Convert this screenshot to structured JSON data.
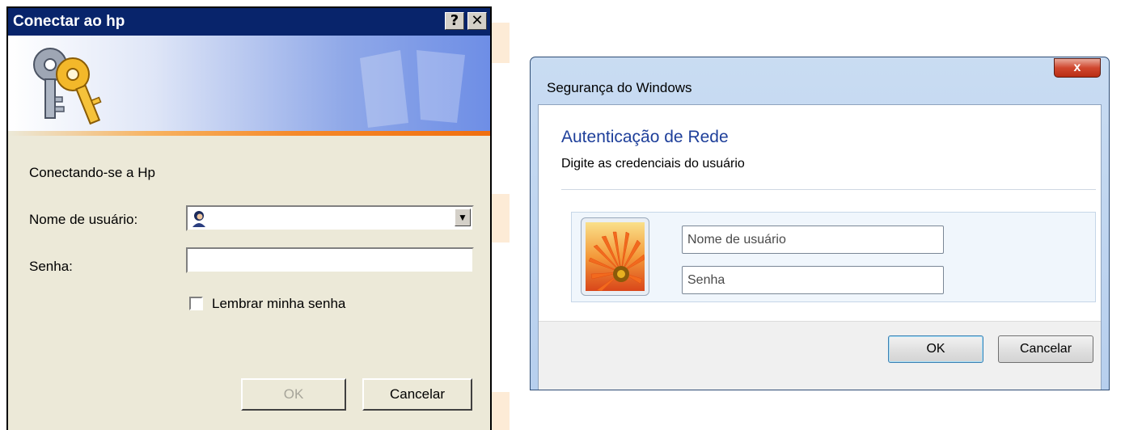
{
  "xp_dialog": {
    "title": "Conectar ao hp",
    "help_button": "?",
    "close_button": "✕",
    "connecting_text": "Conectando-se a Hp",
    "username_label": "Nome de usuário:",
    "username_value": "",
    "password_label": "Senha:",
    "password_value": "",
    "remember_label": "Lembrar minha senha",
    "remember_checked": false,
    "ok_label": "OK",
    "cancel_label": "Cancelar",
    "icons": [
      "keys-icon",
      "user-icon",
      "dropdown-arrow-icon"
    ]
  },
  "win7_dialog": {
    "title": "Segurança do Windows",
    "close_button": "x",
    "heading": "Autenticação de Rede",
    "subheading": "Digite as credenciais do usuário",
    "username_placeholder": "Nome de usuário",
    "password_placeholder": "Senha",
    "ok_label": "OK",
    "cancel_label": "Cancelar",
    "accent_color": "#1e3f9a"
  }
}
